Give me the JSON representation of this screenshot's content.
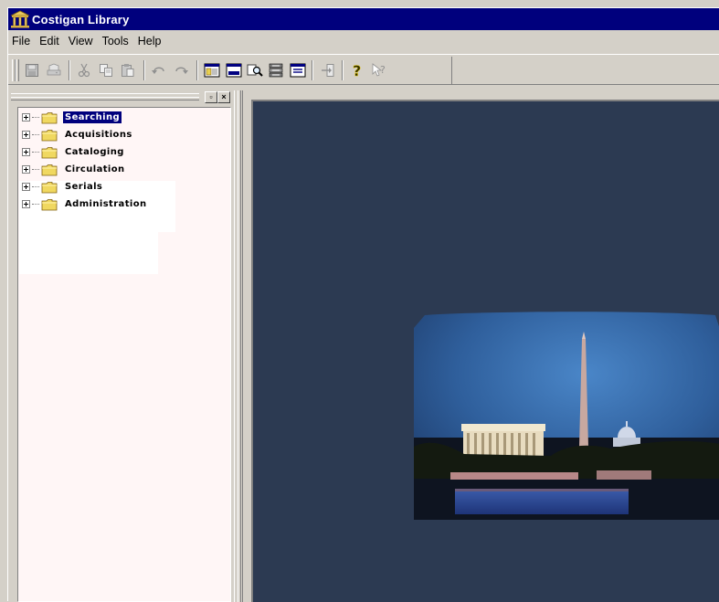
{
  "window": {
    "title": "Costigan Library",
    "title_bar_color": "#00007d",
    "app_icon": "library-building-icon"
  },
  "menu": {
    "items": [
      "File",
      "Edit",
      "View",
      "Tools",
      "Help"
    ]
  },
  "toolbar": {
    "buttons": [
      {
        "name": "save-icon",
        "enabled": false
      },
      {
        "name": "print-icon",
        "enabled": false
      },
      {
        "name": "cut-icon",
        "enabled": false
      },
      {
        "name": "copy-icon",
        "enabled": false
      },
      {
        "name": "paste-icon",
        "enabled": false
      },
      {
        "name": "undo-icon",
        "enabled": false
      },
      {
        "name": "redo-icon",
        "enabled": false
      },
      {
        "name": "navigator-window-icon",
        "enabled": true
      },
      {
        "name": "form-window-icon",
        "enabled": true
      },
      {
        "name": "search-window-icon",
        "enabled": true
      },
      {
        "name": "records-window-icon",
        "enabled": true
      },
      {
        "name": "list-window-icon",
        "enabled": true
      },
      {
        "name": "exit-icon",
        "enabled": false
      },
      {
        "name": "help-icon",
        "enabled": true
      },
      {
        "name": "context-help-icon",
        "enabled": false
      }
    ]
  },
  "navigator": {
    "tree": [
      {
        "label": "Searching",
        "selected": true
      },
      {
        "label": "Acquisitions",
        "selected": false
      },
      {
        "label": "Cataloging",
        "selected": false
      },
      {
        "label": "Circulation",
        "selected": false
      },
      {
        "label": "Serials",
        "selected": false
      },
      {
        "label": "Administration",
        "selected": false
      }
    ],
    "background": "#fff6f6"
  },
  "workspace": {
    "background": "#2c3a52",
    "splash_image": "washington-dc-monuments-skyline"
  }
}
